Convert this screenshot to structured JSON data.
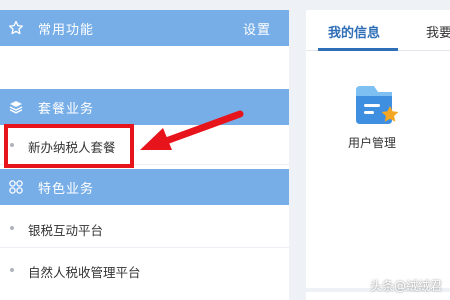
{
  "left_panel": {
    "common": {
      "title": "常用功能",
      "action": "设置",
      "icon": "star-icon"
    },
    "package": {
      "title": "套餐业务",
      "icon": "layers-icon",
      "items": [
        {
          "label": "新办纳税人套餐"
        }
      ]
    },
    "special": {
      "title": "特色业务",
      "icon": "grid-icon",
      "items": [
        {
          "label": "银税互动平台"
        },
        {
          "label": "自然人税收管理平台"
        }
      ]
    }
  },
  "right_panel": {
    "tabs": [
      {
        "label": "我的信息",
        "active": true
      },
      {
        "label": "我要"
      }
    ],
    "apps": [
      {
        "label": "用户管理",
        "icon": "user-management-icon"
      }
    ]
  },
  "watermark": "头条@絨絨君",
  "colors": {
    "header_blue": "#77aee8",
    "active_tab": "#2f6fb8",
    "highlight_red": "#e8141c",
    "star_orange": "#f5a623"
  }
}
